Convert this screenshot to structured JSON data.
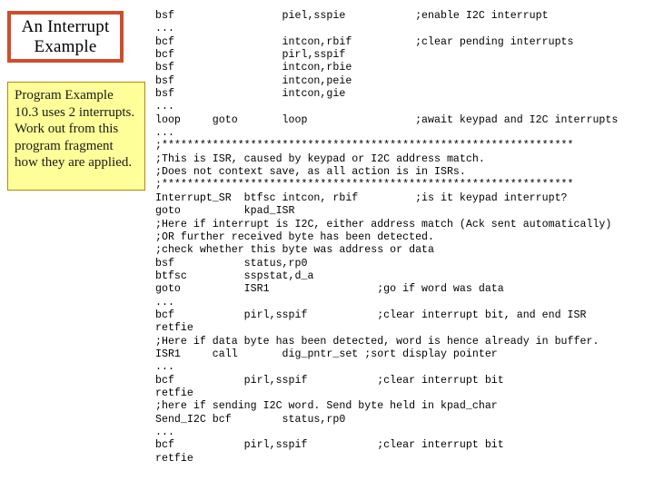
{
  "slide": {
    "title_box": {
      "text": "An Interrupt Example",
      "border_color": "#cf4d2a",
      "fill_color": "#ffffff"
    },
    "note_box": {
      "text": "Program Example 10.3 uses 2 interrupts. Work out from this program fragment how they are applied.",
      "border_color": "#b8860b",
      "fill_color": "#ffff99"
    }
  },
  "code": {
    "language": "PIC assembly",
    "text_color": "#000000",
    "lines": [
      "bsf                 piel,sspie           ;enable I2C interrupt",
      "...",
      "bcf                 intcon,rbif          ;clear pending interrupts",
      "bcf                 pirl,sspif",
      "bsf                 intcon,rbie",
      "bsf                 intcon,peie",
      "bsf                 intcon,gie",
      "...",
      "loop     goto       loop                 ;await keypad and I2C interrupts",
      "...",
      ";*****************************************************************",
      ";This is ISR, caused by keypad or I2C address match.",
      ";Does not context save, as all action is in ISRs.",
      ";*****************************************************************",
      "Interrupt_SR  btfsc intcon, rbif         ;is it keypad interrupt?",
      "goto          kpad_ISR",
      ";Here if interrupt is I2C, either address match (Ack sent automatically)",
      ";OR further received byte has been detected.",
      ";check whether this byte was address or data",
      "bsf           status,rp0",
      "btfsc         sspstat,d_a",
      "goto          ISR1                 ;go if word was data",
      "...",
      "bcf           pirl,sspif           ;clear interrupt bit, and end ISR",
      "retfie",
      ";Here if data byte has been detected, word is hence already in buffer.",
      "ISR1     call       dig_pntr_set ;sort display pointer",
      "...",
      "bcf           pirl,sspif           ;clear interrupt bit",
      "retfie",
      ";here if sending I2C word. Send byte held in kpad_char",
      "Send_I2C bcf        status,rp0",
      "...",
      "bcf           pirl,sspif           ;clear interrupt bit",
      "retfie"
    ]
  }
}
